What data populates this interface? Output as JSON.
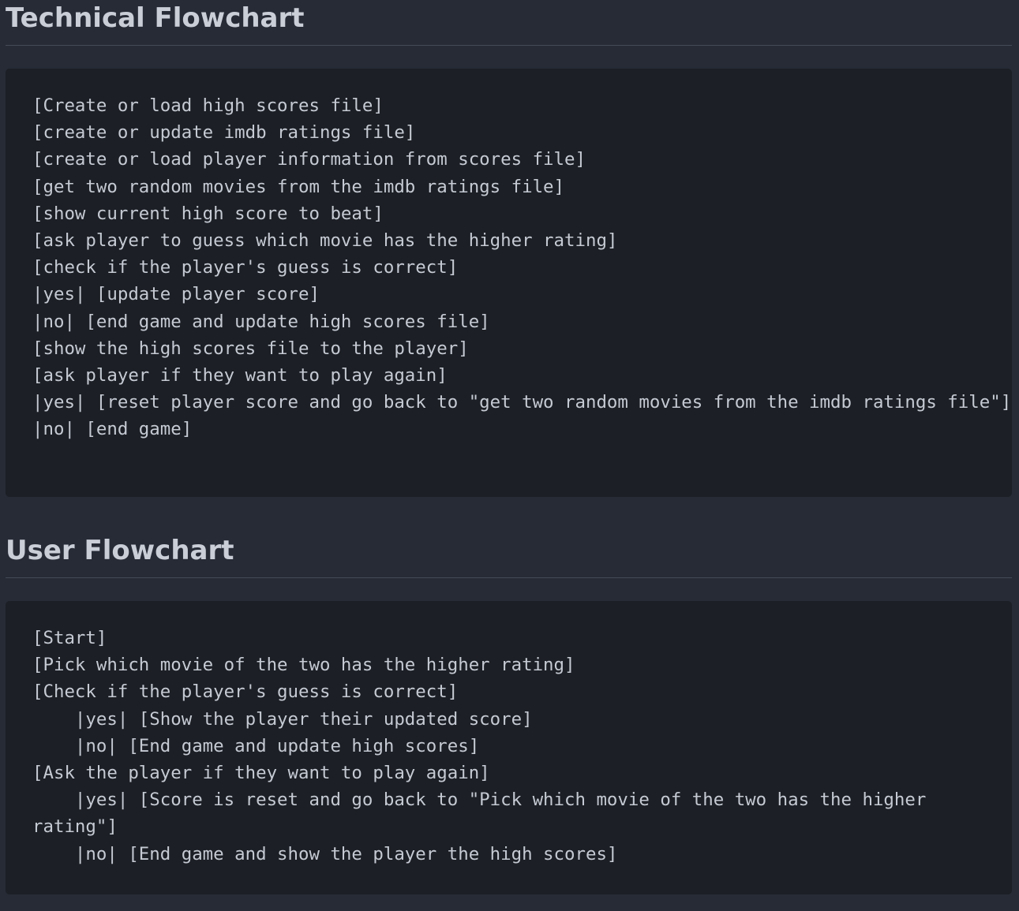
{
  "technical_flowchart": {
    "title": "Technical Flowchart",
    "lines": [
      "[Create or load high scores file]",
      "[create or update imdb ratings file]",
      "[create or load player information from scores file]",
      "[get two random movies from the imdb ratings file]",
      "[show current high score to beat]",
      "[ask player to guess which movie has the higher rating]",
      "[check if the player's guess is correct]",
      "|yes| [update player score]",
      "|no| [end game and update high scores file]",
      "[show the high scores file to the player]",
      "[ask player if they want to play again]",
      "|yes| [reset player score and go back to \"get two random movies from the imdb ratings file\"]",
      "|no| [end game]"
    ]
  },
  "user_flowchart": {
    "title": "User Flowchart",
    "lines": [
      "[Start]",
      "[Pick which movie of the two has the higher rating]",
      "[Check if the player's guess is correct]",
      "    |yes| [Show the player their updated score]",
      "    |no| [End game and update high scores]",
      "[Ask the player if they want to play again]",
      "    |yes| [Score is reset and go back to \"Pick which movie of the two has the higher rating\"]",
      "    |no| [End game and show the player the high scores]"
    ]
  }
}
